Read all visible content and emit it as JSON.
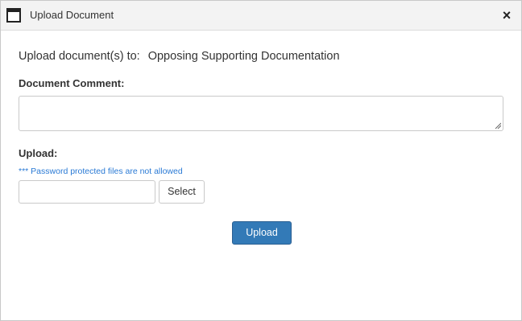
{
  "dialog": {
    "title": "Upload Document",
    "icon": "window-icon",
    "close_label": "×"
  },
  "upload_to": {
    "label": "Upload document(s) to:",
    "destination": "Opposing Supporting Documentation"
  },
  "comment": {
    "label": "Document Comment:",
    "value": ""
  },
  "upload": {
    "label": "Upload:",
    "note": "*** Password protected files are not allowed",
    "file_value": "",
    "select_label": "Select",
    "submit_label": "Upload"
  },
  "colors": {
    "note": "#2a7ad5",
    "primary_button": "#337ab7",
    "titlebar": "#f3f3f3"
  }
}
